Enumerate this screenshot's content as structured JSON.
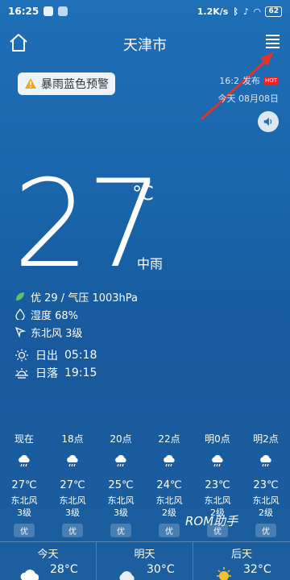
{
  "status": {
    "time": "16:25",
    "speed": "1.2K/s",
    "battery": "62"
  },
  "header": {
    "city": "天津市"
  },
  "alert": {
    "label": "暴雨蓝色预警"
  },
  "publish": {
    "time": "16:2",
    "suffix": "发布",
    "hot": "HOT",
    "date": "今天 08月08日"
  },
  "current": {
    "temperature": "27",
    "unit": "℃",
    "description": "中雨",
    "aqi_pressure": "优 29 / 气压 1003hPa",
    "humidity": "湿度 68%",
    "wind": "东北风 3级",
    "sunrise_label": "日出",
    "sunrise_time": "05:18",
    "sunset_label": "日落",
    "sunset_time": "19:15"
  },
  "hourly": [
    {
      "time": "现在",
      "temp": "27℃",
      "wind": "东北风",
      "level": "3级",
      "aqi": "优"
    },
    {
      "time": "18点",
      "temp": "27℃",
      "wind": "东北风",
      "level": "3级",
      "aqi": "优"
    },
    {
      "time": "20点",
      "temp": "25℃",
      "wind": "东北风",
      "level": "3级",
      "aqi": "优"
    },
    {
      "time": "22点",
      "temp": "24℃",
      "wind": "东北风",
      "level": "2级",
      "aqi": "优"
    },
    {
      "time": "明0点",
      "temp": "23℃",
      "wind": "东北风",
      "level": "2级",
      "aqi": "优"
    },
    {
      "time": "明2点",
      "temp": "23℃",
      "wind": "东北风",
      "level": "2级",
      "aqi": "优"
    }
  ],
  "watermark": "ROM助手",
  "daily": [
    {
      "name": "今天",
      "temp": "28°C"
    },
    {
      "name": "明天",
      "temp": "30°C"
    },
    {
      "name": "后天",
      "temp": "32°C"
    }
  ],
  "colors": {
    "accent_arrow": "#e0352b",
    "alert_icon": "#f3a51b"
  }
}
